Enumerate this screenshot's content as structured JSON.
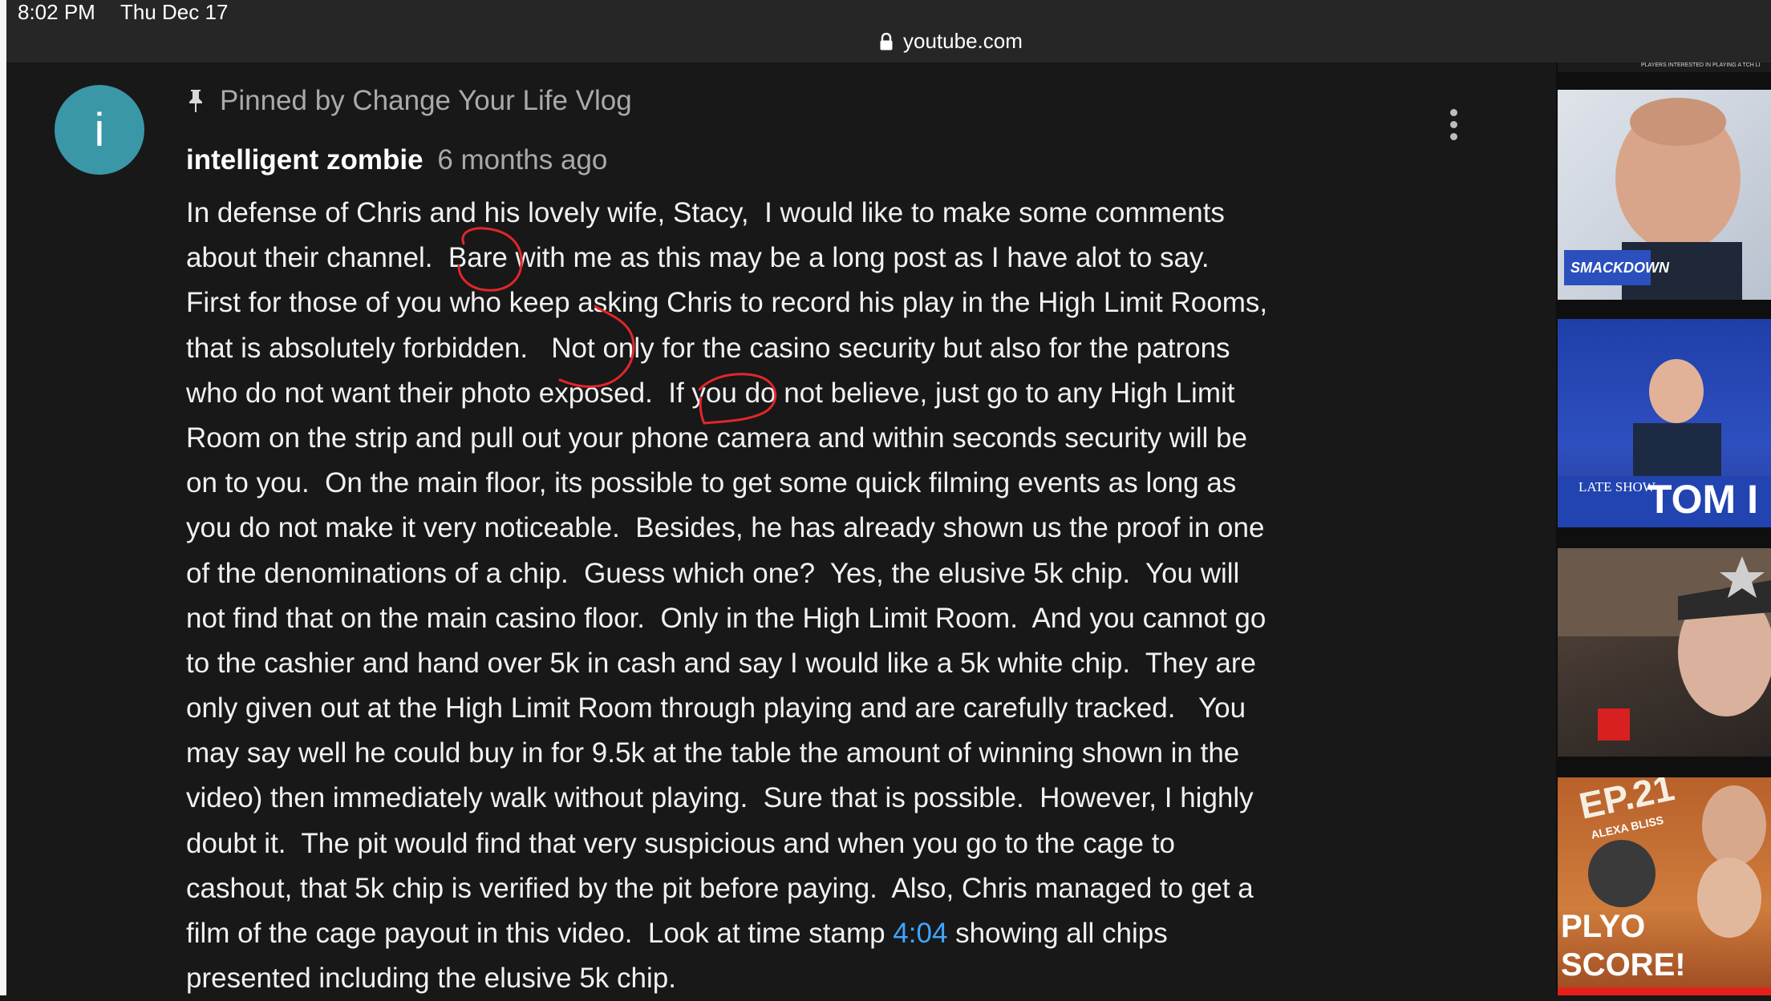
{
  "status_bar": {
    "time": "8:02 PM",
    "date": "Thu Dec 17"
  },
  "browser": {
    "url": "youtube.com"
  },
  "comment": {
    "avatar_letter": "i",
    "pinned_label": "Pinned by Change Your Life Vlog",
    "author": "intelligent zombie",
    "time_ago": "6 months ago",
    "timestamp_link": "4:04",
    "lines": [
      "In defense of Chris and his lovely wife, Stacy,  I would like to make some comments",
      "about their channel.  Bare with me as this may be a long post as I have alot to say.",
      "First for those of you who keep asking Chris to record his play in the High Limit Rooms,",
      "that is absolutely forbidden.   Not only for the casino security but also for the patrons",
      "who do not want their photo exposed.  If you do not believe, just go to any High Limit",
      "Room on the strip and pull out your phone camera and within seconds security will be",
      "on to you.  On the main floor, its possible to get some quick filming events as long as",
      "you do not make it very noticeable.  Besides, he has already shown us the proof in one",
      "of the denominations of a chip.  Guess which one?  Yes, the elusive 5k chip.  You will",
      "not find that on the main casino floor.  Only in the High Limit Room.  And you cannot go",
      "to the cashier and hand over 5k in cash and say I would like a 5k white chip.  They are",
      "only given out at the High Limit Room through playing and are carefully tracked.   You",
      "may say well he could buy in for 9.5k at the table the amount of winning shown in the",
      "video) then immediately walk without playing.  Sure that is possible.  However, I highly",
      "doubt it.  The pit would find that very suspicious and when you go to the cage to",
      "cashout, that 5k chip is verified by the pit before paying.  Also, Chris managed to get a"
    ],
    "line17_before": "film of the cage payout in this video.  Look at time stamp ",
    "line17_after": " showing all chips",
    "line18": "presented including the elusive 5k chip."
  },
  "sidebar": {
    "thumb_top_text": "PLAYERS INTERESTED IN PLAYING A TCH LI",
    "thumb1_text": "SMACKDOWN",
    "thumb2_brand": "LATE SHOW",
    "thumb2_text": "TOM I",
    "thumb4_line1": "EP.21",
    "thumb4_line2": "ALEXA BLISS",
    "thumb4_line3": "PLYO",
    "thumb4_line4": "SCORE!"
  },
  "colors": {
    "link": "#3ea6ff",
    "avatar": "#3a97a7",
    "annotation": "#e3262b"
  }
}
